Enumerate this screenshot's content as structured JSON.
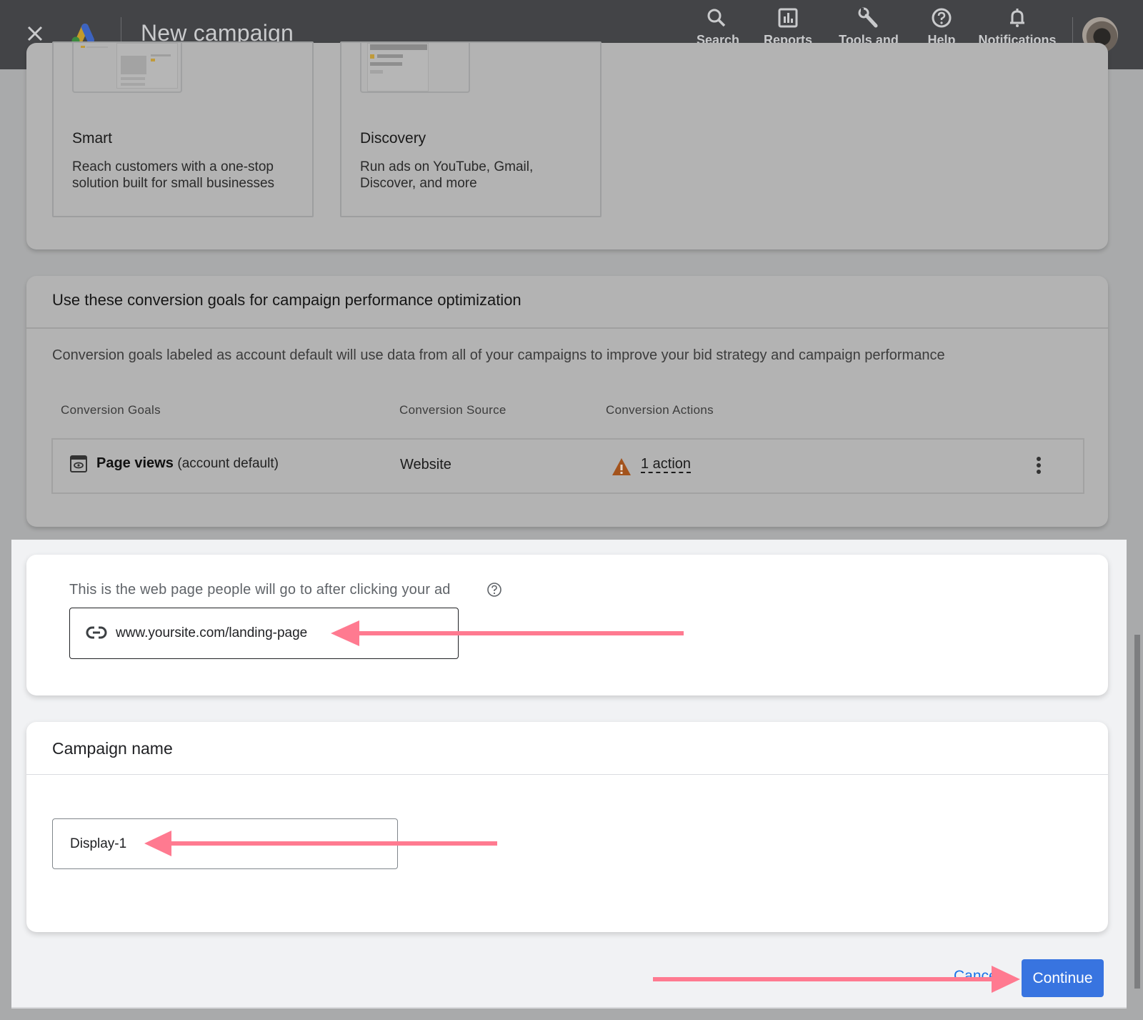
{
  "header": {
    "title": "New campaign",
    "nav": [
      {
        "label": "Search",
        "icon": "search-icon"
      },
      {
        "label": "Reports",
        "icon": "reports-icon"
      },
      {
        "label": "Tools and settings",
        "icon": "wrench-icon"
      },
      {
        "label": "Help",
        "icon": "help-icon"
      },
      {
        "label": "Notifications",
        "icon": "bell-icon"
      }
    ]
  },
  "campaign_types": [
    {
      "title": "Smart",
      "description": "Reach customers with a one-stop solution built for small businesses"
    },
    {
      "title": "Discovery",
      "description": "Run ads on YouTube, Gmail, Discover, and more"
    }
  ],
  "conversion_goals": {
    "title": "Use these conversion goals for campaign performance optimization",
    "description": "Conversion goals labeled as account default will use data from all of your campaigns to improve your bid strategy and campaign performance",
    "columns": [
      "Conversion Goals",
      "Conversion Source",
      "Conversion Actions"
    ],
    "rows": [
      {
        "goal": "Page views",
        "goal_note": "(account default)",
        "source": "Website",
        "actions": "1 action",
        "warning": true
      }
    ]
  },
  "landing_page": {
    "label": "This is the web page people will go to after clicking your ad",
    "value": "www.yoursite.com/landing-page"
  },
  "campaign_name": {
    "title": "Campaign name",
    "value": "Display-1"
  },
  "footer": {
    "cancel_label": "Cancel",
    "continue_label": "Continue"
  },
  "colors": {
    "accent": "#3874e0",
    "annotation_arrow": "#ff7a90",
    "warning": "#a3531c",
    "header_bg": "#434447"
  }
}
